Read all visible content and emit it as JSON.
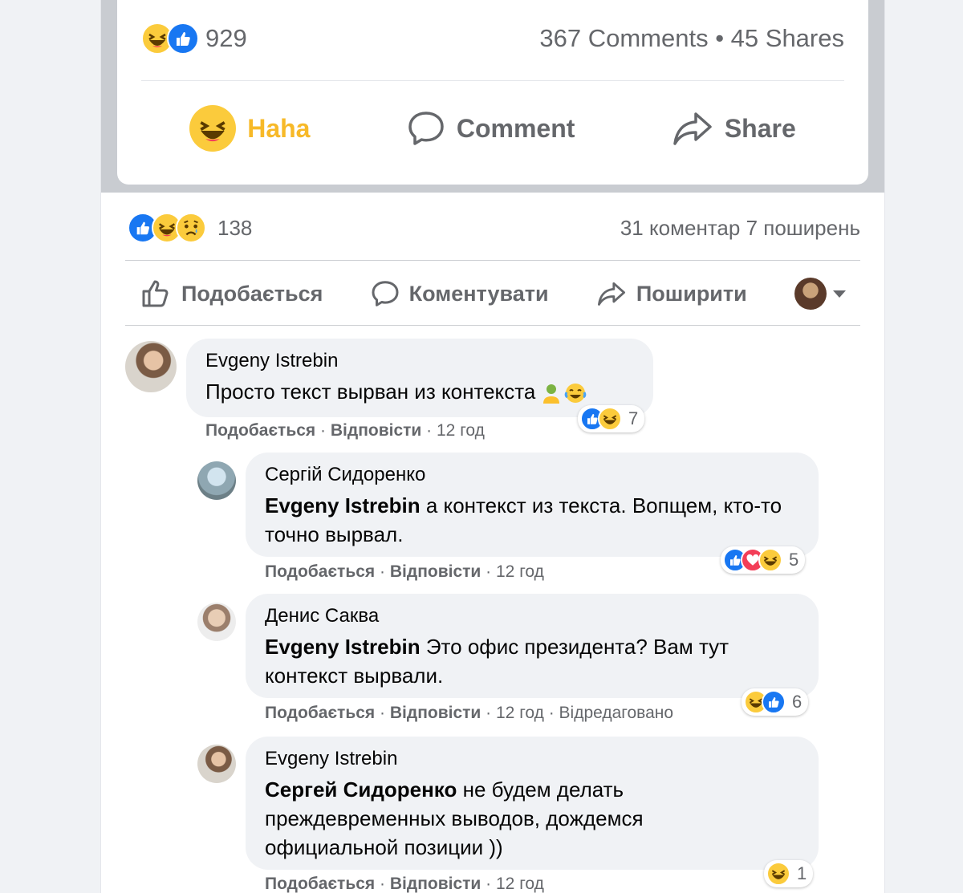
{
  "top_post": {
    "reaction_count": "929",
    "comments_shares": "367 Comments • 45 Shares",
    "actions": {
      "haha": "Haha",
      "comment": "Comment",
      "share": "Share"
    }
  },
  "post": {
    "reaction_count": "138",
    "comments_shares": "31 коментар  7 поширень",
    "actions": {
      "like": "Подобається",
      "comment": "Коментувати",
      "share": "Поширити"
    }
  },
  "comments": [
    {
      "author": "Evgeny Istrebin",
      "mention": "",
      "text": "Просто текст вырван из контекста",
      "like": "Подобається",
      "reply": "Відповісти",
      "time": "12 год",
      "extra": "",
      "reactions": [
        "like-icon",
        "haha-icon"
      ],
      "reaction_count": "7"
    },
    {
      "author": "Сергій Сидоренко",
      "mention": "Evgeny Istrebin",
      "text": " а контекст из текста. Вопщем, кто-то точно вырвал.",
      "like": "Подобається",
      "reply": "Відповісти",
      "time": "12 год",
      "extra": "",
      "reactions": [
        "like-icon",
        "love-icon",
        "haha-icon"
      ],
      "reaction_count": "5"
    },
    {
      "author": "Денис Саква",
      "mention": "Evgeny Istrebin",
      "text": " Это офис президента? Вам тут контекст вырвали.",
      "like": "Подобається",
      "reply": "Відповісти",
      "time": "12 год",
      "extra": "Відредаговано",
      "reactions": [
        "haha-icon",
        "like-icon"
      ],
      "reaction_count": "6"
    },
    {
      "author": "Evgeny Istrebin",
      "mention": "Сергей Сидоренко",
      "text": " не будем делать преждевременных выводов, дождемся официальной позиции ))",
      "like": "Подобається",
      "reply": "Відповісти",
      "time": "12 год",
      "extra": "",
      "reactions": [
        "haha-icon"
      ],
      "reaction_count": "1"
    }
  ],
  "colors": {
    "accent": "#1877f2",
    "haha": "#f7b928",
    "love": "#f33e58",
    "muted": "#65676b"
  }
}
